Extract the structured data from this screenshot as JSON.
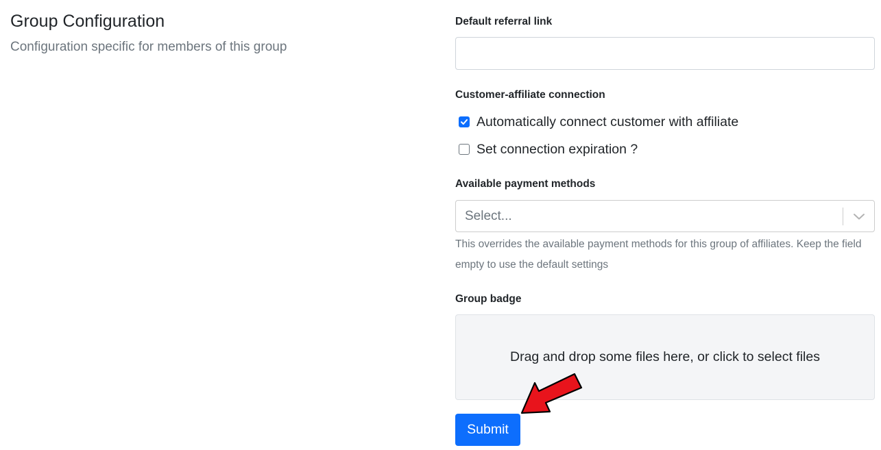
{
  "section": {
    "title": "Group Configuration",
    "subtitle": "Configuration specific for members of this group"
  },
  "form": {
    "referral_link": {
      "label": "Default referral link",
      "value": "",
      "placeholder": ""
    },
    "connection": {
      "label": "Customer-affiliate connection",
      "options": [
        {
          "label": "Automatically connect customer with affiliate",
          "checked": true
        },
        {
          "label": "Set connection expiration ?",
          "checked": false
        }
      ]
    },
    "payment_methods": {
      "label": "Available payment methods",
      "placeholder": "Select...",
      "help": "This overrides the available payment methods for this group of affiliates. Keep the field empty to use the default settings"
    },
    "badge": {
      "label": "Group badge",
      "dropzone_text": "Drag and drop some files here, or click to select files"
    },
    "submit_label": "Submit"
  },
  "colors": {
    "primary": "#0d6efd",
    "annotation_arrow": "#e8141c"
  }
}
